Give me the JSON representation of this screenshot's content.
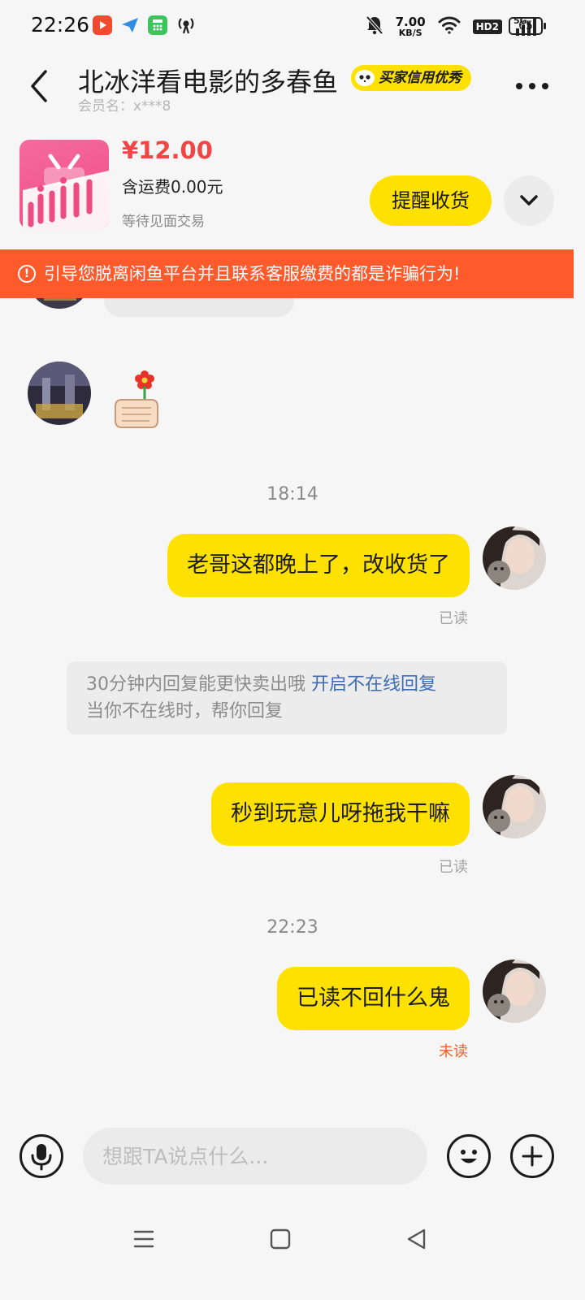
{
  "status_bar": {
    "time": "22:26",
    "net_speed_value": "7.00",
    "net_speed_unit": "KB/S",
    "hd_label": "HD2",
    "network_label": "5G",
    "battery": "65"
  },
  "header": {
    "title": "北冰洋看电影的多春鱼",
    "credit_badge": "买家信用优秀",
    "member_label": "会员名：x***8"
  },
  "product": {
    "price": "¥12.00",
    "shipping": "含运费0.00元",
    "status": "等待见面交易",
    "remind_button": "提醒收货"
  },
  "warning": {
    "text": "引导您脱离闲鱼平台并且联系客服缴费的都是诈骗行为!"
  },
  "chat": {
    "time_1": "18:14",
    "msg_1": "老哥这都晚上了，改收货了",
    "read_1": "已读",
    "tip_line1": "30分钟内回复能更快卖出哦",
    "tip_link": "开启不在线回复",
    "tip_line2": "当你不在线时，帮你回复",
    "msg_2": "秒到玩意儿呀拖我干嘛",
    "read_2": "已读",
    "time_2": "22:23",
    "msg_3": "已读不回什么鬼",
    "read_3": "未读"
  },
  "input": {
    "placeholder": "想跟TA说点什么..."
  },
  "colors": {
    "accent_yellow": "#ffe100",
    "warning_orange": "#ff5a2c",
    "price_red": "#f24545",
    "unread_orange": "#e8622a",
    "link_blue": "#3f6cb0"
  },
  "icons": {
    "back": "chevron-left-icon",
    "more": "more-dots-icon",
    "expand": "chevron-down-icon",
    "warning": "exclamation-circle-icon",
    "voice": "microphone-icon",
    "emoji": "smile-icon",
    "plus": "plus-icon",
    "nav_menu": "menu-lines-icon",
    "nav_home": "square-home-icon",
    "nav_back": "triangle-back-icon"
  }
}
